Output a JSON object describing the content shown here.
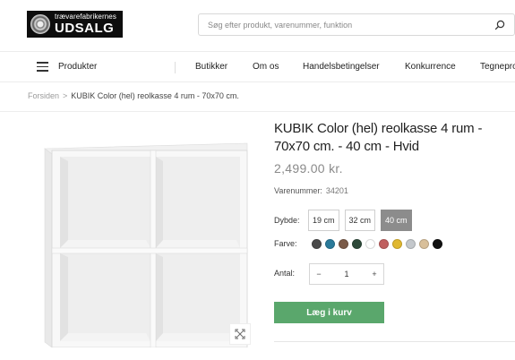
{
  "header": {
    "logo_top": "trævarefabrikernes",
    "logo_main": "UDSALG",
    "search_placeholder": "Søg efter produkt, varenummer, funktion"
  },
  "nav": {
    "products_label": "Produkter",
    "items": [
      "Butikker",
      "Om os",
      "Handelsbetingelser",
      "Konkurrence",
      "Tegnepro"
    ]
  },
  "breadcrumb": {
    "home": "Forsiden",
    "separator": ">",
    "current": "KUBIK Color (hel) reolkasse 4 rum - 70x70 cm."
  },
  "product": {
    "title": "KUBIK Color (hel) reolkasse 4 rum - 70x70 cm. - 40 cm - Hvid",
    "price": "2,499.00  kr.",
    "sku_label": "Varenummer:",
    "sku_value": "34201",
    "depth_label": "Dybde:",
    "depth_options": [
      "19 cm",
      "32 cm",
      "40 cm"
    ],
    "depth_selected": "40 cm",
    "color_label": "Farve:",
    "colors": [
      "#4a4a4a",
      "#2a7a9a",
      "#7a5a48",
      "#2e4a3a",
      "#ffffff",
      "#c06060",
      "#e0b830",
      "#c4c8cc",
      "#d8bf9a",
      "#111111"
    ],
    "qty_label": "Antal:",
    "qty_minus": "−",
    "qty_value": "1",
    "qty_plus": "+",
    "add_to_cart": "Læg i kurv"
  },
  "colors": {
    "accent_green": "#5aa76c",
    "selected_option": "#8c8c8c",
    "price_grey": "#8a8a8a"
  }
}
